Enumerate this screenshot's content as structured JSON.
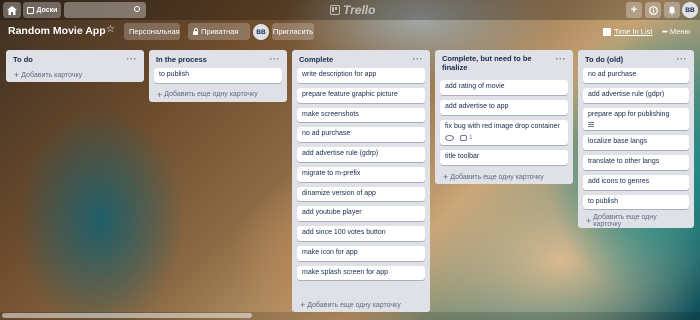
{
  "topbar": {
    "boards_label": "Доски",
    "logo_text": "Trello",
    "avatar_initials": "BB"
  },
  "board": {
    "title": "Random Movie App",
    "team_label": "Персональная",
    "visibility_label": "Приватная",
    "member_initials": "BB",
    "invite_label": "Пригласить",
    "time_in_list_label": "Time In List",
    "menu_label": "Меню"
  },
  "lists": [
    {
      "name": "To do",
      "cards": [],
      "add_label": "Добавить карточку"
    },
    {
      "name": "In the process",
      "cards": [
        {
          "title": "to publish"
        }
      ],
      "add_label": "Добавить еще одну карточку"
    },
    {
      "name": "Complete",
      "cards": [
        {
          "title": "write description for app"
        },
        {
          "title": "prepare feature graphic picture"
        },
        {
          "title": "make screenshots"
        },
        {
          "title": "no ad purchase"
        },
        {
          "title": "add advertise rule (gdrp)"
        },
        {
          "title": "migrate to m-prefix"
        },
        {
          "title": "dinamize version of app"
        },
        {
          "title": "add youtube player"
        },
        {
          "title": "add since 100 votes button"
        },
        {
          "title": "make icon for app"
        },
        {
          "title": "make splash screen for app"
        }
      ],
      "add_label": "Добавить еще одну карточку"
    },
    {
      "name": "Complete, but need to be finalize",
      "cards": [
        {
          "title": "add rating of movie"
        },
        {
          "title": "add advertise to app"
        },
        {
          "title": "fix bug with red image drop container",
          "badges": {
            "watching": true,
            "comments": "1"
          }
        },
        {
          "title": "title toolbar"
        }
      ],
      "add_label": "Добавить еще одну карточку"
    },
    {
      "name": "To do (old)",
      "cards": [
        {
          "title": "no ad purchase"
        },
        {
          "title": "add advertise rule (gdpr)"
        },
        {
          "title": "prepare app for publishing",
          "badges": {
            "description": true
          }
        },
        {
          "title": "localize base langs"
        },
        {
          "title": "translate to other langs"
        },
        {
          "title": "add icons to genres"
        },
        {
          "title": "to publish"
        }
      ],
      "add_label": "Добавить еще одну карточку"
    }
  ]
}
